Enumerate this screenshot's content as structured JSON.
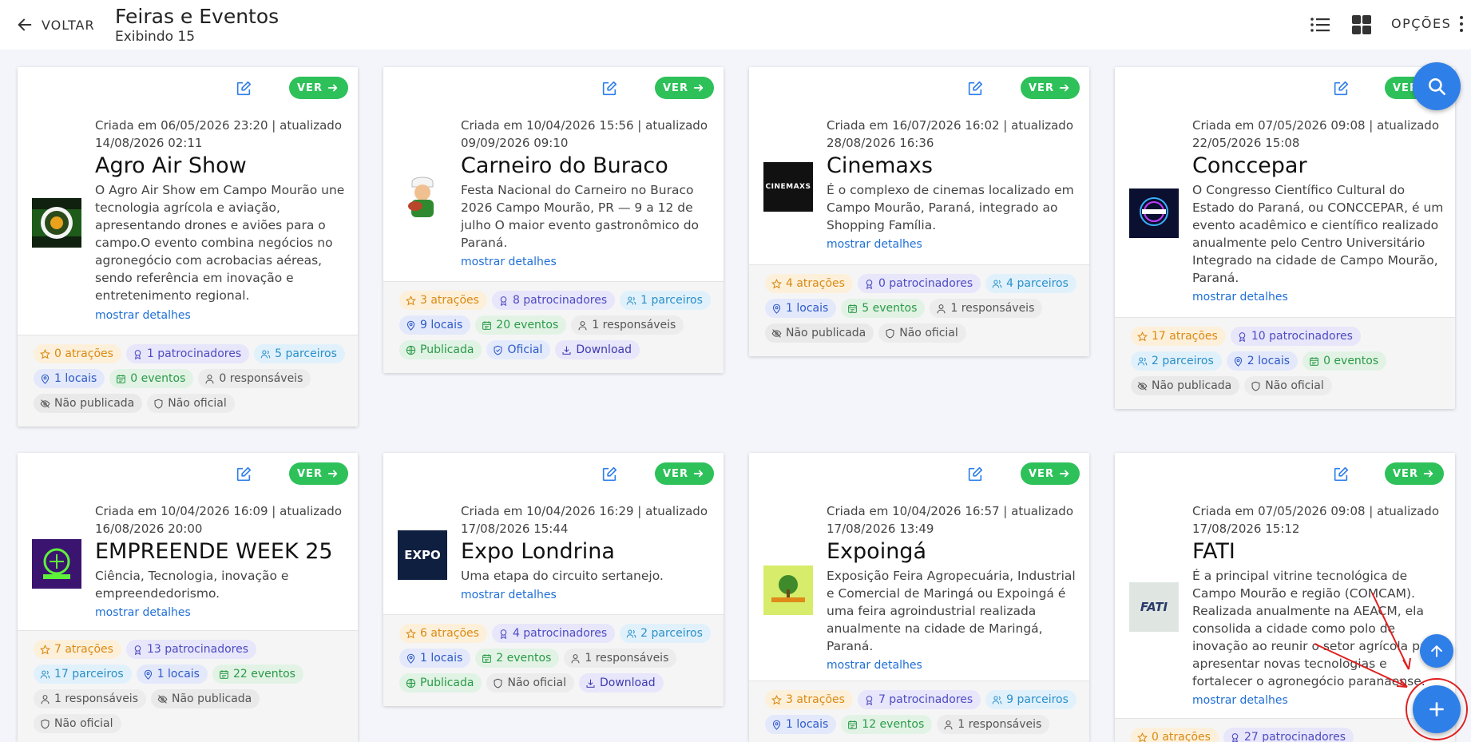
{
  "header": {
    "back_label": "VOLTAR",
    "title": "Feiras e Eventos",
    "subtitle": "Exibindo 15",
    "options_label": "OPÇÕES"
  },
  "common": {
    "ver_label": "VER",
    "more_label": "mostrar detalhes"
  },
  "cards": [
    {
      "meta": "Criada em 06/05/2026 23:20 | atualizado 14/08/2026 02:11",
      "title": "Agro Air Show",
      "description": "O Agro Air Show em Campo Mourão une tecnologia agrícola e aviação, apresentando drones e aviões para o campo.O evento combina negócios no agronegócio com acrobacias aéreas, sendo referência em inovação e entretenimento regional.",
      "chips": [
        "0 atrações",
        "1 patrocinadores",
        "5 parceiros",
        "1 locais",
        "0 eventos",
        "0 responsáveis",
        "Não publicada",
        "Não oficial"
      ]
    },
    {
      "meta": "Criada em 10/04/2026 15:56 | atualizado 09/09/2026 09:10",
      "title": "Carneiro do Buraco",
      "description": "Festa Nacional do Carneiro no Buraco 2026 Campo Mourão, PR — 9 a 12 de julho O maior evento gastronômico do Paraná.",
      "chips": [
        "3 atrações",
        "8 patrocinadores",
        "1 parceiros",
        "9 locais",
        "20 eventos",
        "1 responsáveis",
        "Publicada",
        "Oficial",
        "Download"
      ]
    },
    {
      "meta": "Criada em 16/07/2026 16:02 | atualizado 28/08/2026 16:36",
      "title": "Cinemaxs",
      "description": "É o complexo de cinemas localizado em Campo Mourão, Paraná, integrado ao Shopping Família.",
      "logo_text": "CINEMAXS",
      "chips": [
        "4 atrações",
        "0 patrocinadores",
        "4 parceiros",
        "1 locais",
        "5 eventos",
        "1 responsáveis",
        "Não publicada",
        "Não oficial"
      ]
    },
    {
      "meta": "Criada em 07/05/2026 09:08 | atualizado 22/05/2026 15:08",
      "title": "Conccepar",
      "description": "O Congresso Científico Cultural do Estado do Paraná, ou CONCCEPAR, é um evento acadêmico e científico realizado anualmente pelo Centro Universitário Integrado na cidade de Campo Mourão, Paraná.",
      "chips": [
        "17 atrações",
        "10 patrocinadores",
        "2 parceiros",
        "2 locais",
        "0 eventos",
        "Não publicada",
        "Não oficial"
      ]
    },
    {
      "meta": "Criada em 10/04/2026 16:09 | atualizado 16/08/2026 20:00",
      "title": "EMPREENDE WEEK 25",
      "description": "Ciência, Tecnologia, inovação e empreendedorismo.",
      "chips": [
        "7 atrações",
        "13 patrocinadores",
        "17 parceiros",
        "1 locais",
        "22 eventos",
        "1 responsáveis",
        "Não publicada",
        "Não oficial"
      ]
    },
    {
      "meta": "Criada em 10/04/2026 16:29 | atualizado 17/08/2026 15:44",
      "title": "Expo Londrina",
      "description": "Uma etapa do circuito sertanejo.",
      "logo_text": "EXPO",
      "chips": [
        "6 atrações",
        "4 patrocinadores",
        "2 parceiros",
        "1 locais",
        "2 eventos",
        "1 responsáveis",
        "Publicada",
        "Não oficial",
        "Download"
      ]
    },
    {
      "meta": "Criada em 10/04/2026 16:57 | atualizado 17/08/2026 13:49",
      "title": "Expoingá",
      "description": "Exposição Feira Agropecuária, Industrial e Comercial de Maringá ou Expoingá é uma feira agroindustrial realizada anualmente na cidade de Maringá, Paraná.",
      "chips": [
        "3 atrações",
        "7 patrocinadores",
        "9 parceiros",
        "1 locais",
        "12 eventos",
        "1 responsáveis"
      ]
    },
    {
      "meta": "Criada em 07/05/2026 09:08 | atualizado 17/08/2026 15:12",
      "title": "FATI",
      "description": "É a principal vitrine tecnológica de Campo Mourão e região (COMCAM). Realizada anualmente na AEACM, ela consolida a cidade como polo de inovação ao reunir o setor agrícola para apresentar novas tecnologias e fortalecer o agronegócio paranaense.",
      "logo_text": "FATI",
      "chips": [
        "0 atrações",
        "27 patrocinadores"
      ]
    }
  ]
}
